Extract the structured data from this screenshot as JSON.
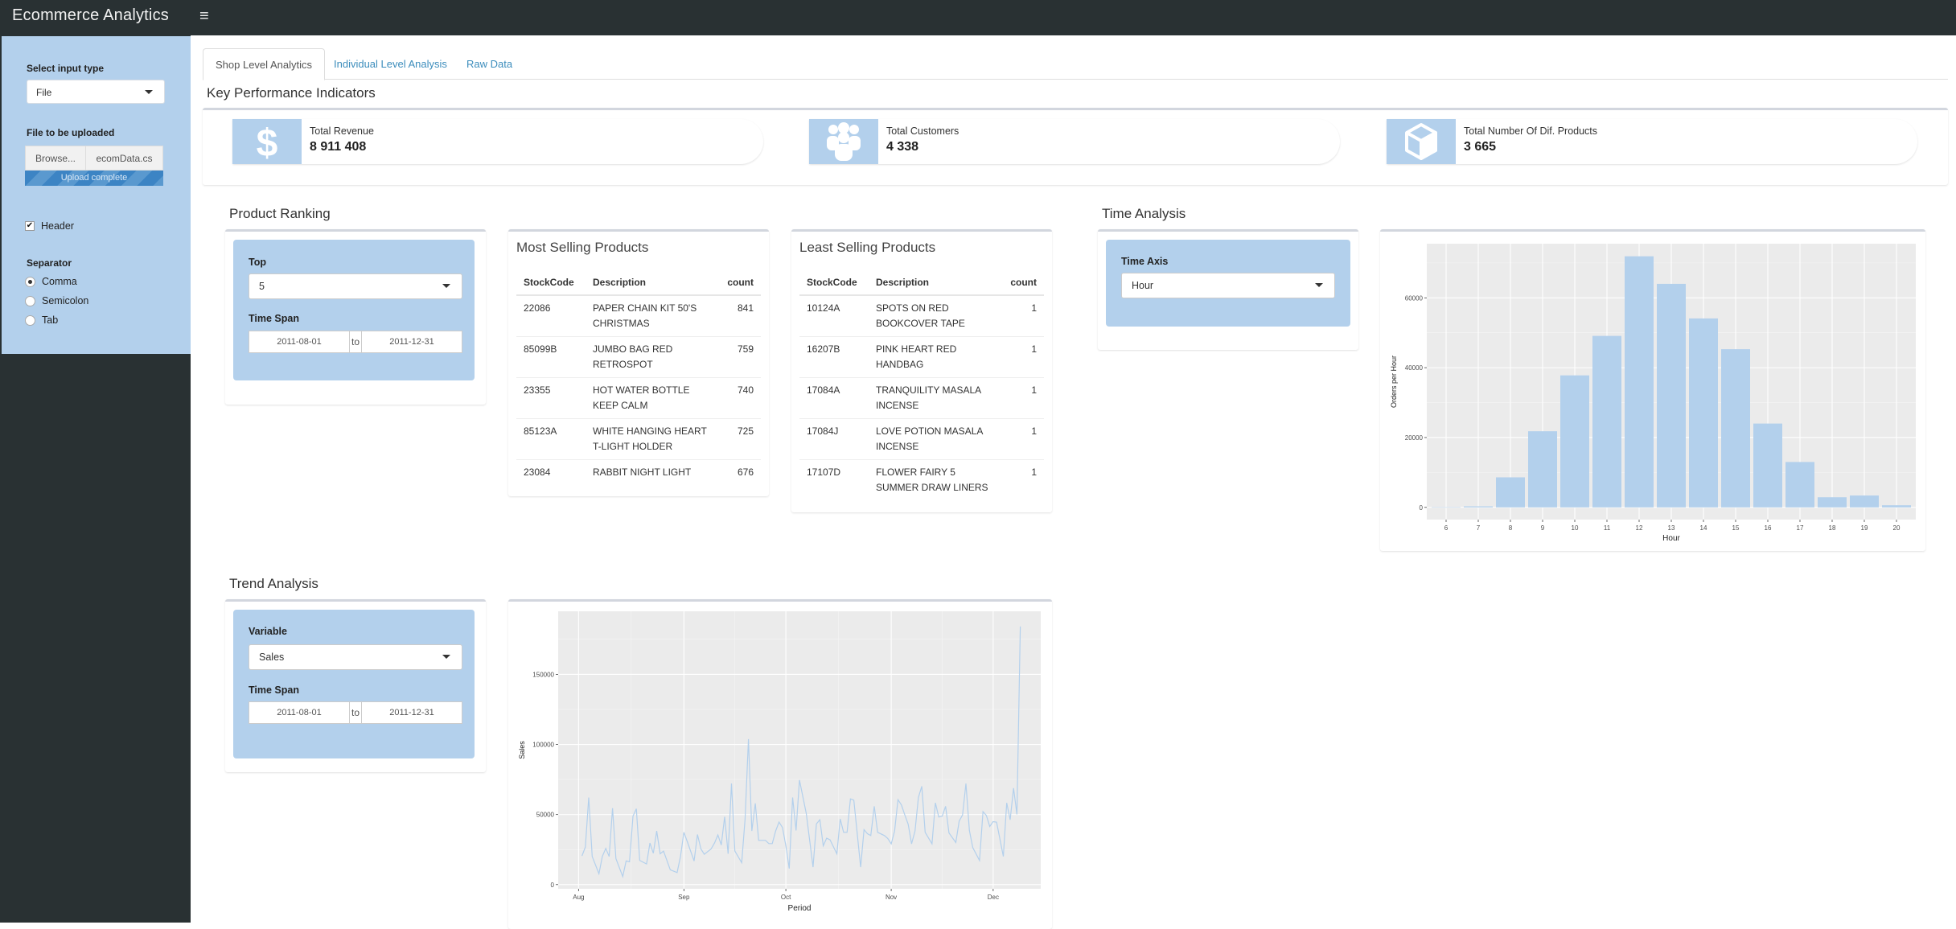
{
  "app": {
    "title": "Ecommerce Analytics",
    "menu_icon": "hamburger-icon"
  },
  "sidebar": {
    "input_type_label": "Select input type",
    "input_type_value": "File",
    "file_label": "File to be uploaded",
    "browse_label": "Browse...",
    "file_name": "ecomData.cs",
    "upload_status": "Upload complete",
    "upload_progress": 1.0,
    "header_label": "Header",
    "header_checked": true,
    "separator_label": "Separator",
    "separator_options": [
      {
        "label": "Comma",
        "selected": true
      },
      {
        "label": "Semicolon",
        "selected": false
      },
      {
        "label": "Tab",
        "selected": false
      }
    ]
  },
  "tabs": [
    {
      "label": "Shop Level Analytics",
      "active": true
    },
    {
      "label": "Individual Level Analysis",
      "active": false
    },
    {
      "label": "Raw Data",
      "active": false
    }
  ],
  "kpi": {
    "title": "Key Performance Indicators",
    "items": [
      {
        "icon": "dollar-icon",
        "label": "Total Revenue",
        "value": "8 911 408"
      },
      {
        "icon": "users-icon",
        "label": "Total Customers",
        "value": "4 338"
      },
      {
        "icon": "cube-icon",
        "label": "Total Number Of Dif. Products",
        "value": "3 665"
      }
    ]
  },
  "product_ranking": {
    "title": "Product Ranking",
    "top_label": "Top",
    "top_value": "5",
    "timespan_label": "Time Span",
    "date_from": "2011-08-01",
    "date_sep": "to",
    "date_to": "2011-12-31"
  },
  "most_selling": {
    "title": "Most Selling Products",
    "columns": [
      "StockCode",
      "Description",
      "count"
    ],
    "rows": [
      [
        "22086",
        "PAPER CHAIN KIT 50'S CHRISTMAS",
        "841"
      ],
      [
        "85099B",
        "JUMBO BAG RED RETROSPOT",
        "759"
      ],
      [
        "23355",
        "HOT WATER BOTTLE KEEP CALM",
        "740"
      ],
      [
        "85123A",
        "WHITE HANGING HEART T-LIGHT HOLDER",
        "725"
      ],
      [
        "23084",
        "RABBIT NIGHT LIGHT",
        "676"
      ]
    ]
  },
  "least_selling": {
    "title": "Least Selling Products",
    "columns": [
      "StockCode",
      "Description",
      "count"
    ],
    "rows": [
      [
        "10124A",
        "SPOTS ON RED BOOKCOVER TAPE",
        "1"
      ],
      [
        "16207B",
        "PINK HEART RED HANDBAG",
        "1"
      ],
      [
        "17084A",
        "TRANQUILITY MASALA INCENSE",
        "1"
      ],
      [
        "17084J",
        "LOVE POTION MASALA INCENSE",
        "1"
      ],
      [
        "17107D",
        "FLOWER FAIRY 5 SUMMER DRAW LINERS",
        "1"
      ]
    ]
  },
  "time_analysis": {
    "title": "Time Analysis",
    "axis_label": "Time Axis",
    "axis_value": "Hour"
  },
  "trend_analysis": {
    "title": "Trend Analysis",
    "variable_label": "Variable",
    "variable_value": "Sales",
    "timespan_label": "Time Span",
    "date_from": "2011-08-01",
    "date_sep": "to",
    "date_to": "2011-12-31"
  },
  "colors": {
    "bar": "#b3d0ec",
    "panel": "#ebebeb",
    "accent": "#3c8dbc",
    "topbar": "#293133"
  },
  "chart_data": [
    {
      "type": "bar",
      "title": "",
      "xlabel": "Hour",
      "ylabel": "Orders per  Hour",
      "categories": [
        "6",
        "7",
        "8",
        "9",
        "10",
        "11",
        "12",
        "13",
        "14",
        "15",
        "16",
        "17",
        "18",
        "19",
        "20"
      ],
      "values": [
        41,
        300,
        8600,
        21800,
        37800,
        49100,
        71900,
        64000,
        54100,
        45300,
        24000,
        13000,
        2900,
        3400,
        600
      ],
      "yticks": [
        0,
        20000,
        40000,
        60000
      ],
      "ylim": [
        -3500,
        75500
      ],
      "grid": true,
      "legend": "none"
    },
    {
      "type": "line",
      "title": "",
      "xlabel": "Period",
      "ylabel": "Sales",
      "xticks": [
        {
          "date": "2011-08-01",
          "label": "Aug"
        },
        {
          "date": "2011-09-01",
          "label": "Sep"
        },
        {
          "date": "2011-10-01",
          "label": "Oct"
        },
        {
          "date": "2011-11-01",
          "label": "Nov"
        },
        {
          "date": "2011-12-01",
          "label": "Dec"
        }
      ],
      "yticks": [
        0,
        50000,
        100000,
        150000
      ],
      "xlim": [
        "2011-07-26",
        "2011-12-15"
      ],
      "ylim": [
        -3000,
        195000
      ],
      "grid": true,
      "legend": "none",
      "series": [
        {
          "name": "Sales",
          "points": [
            [
              "2011-08-02",
              20450
            ],
            [
              "2011-08-03",
              26770
            ],
            [
              "2011-08-04",
              62140
            ],
            [
              "2011-08-05",
              20080
            ],
            [
              "2011-08-07",
              7650
            ],
            [
              "2011-08-08",
              20080
            ],
            [
              "2011-08-09",
              25810
            ],
            [
              "2011-08-10",
              20080
            ],
            [
              "2011-08-11",
              54490
            ],
            [
              "2011-08-12",
              18550
            ],
            [
              "2011-08-14",
              5740
            ],
            [
              "2011-08-15",
              16830
            ],
            [
              "2011-08-16",
              16250
            ],
            [
              "2011-08-17",
              48760
            ],
            [
              "2011-08-18",
              54110
            ],
            [
              "2011-08-19",
              17210
            ],
            [
              "2011-08-21",
              14720
            ],
            [
              "2011-08-22",
              29640
            ],
            [
              "2011-08-23",
              22370
            ],
            [
              "2011-08-24",
              38240
            ],
            [
              "2011-08-25",
              21990
            ],
            [
              "2011-08-26",
              23900
            ],
            [
              "2011-08-28",
              10520
            ],
            [
              "2011-08-30",
              8600
            ],
            [
              "2011-08-31",
              20080
            ],
            [
              "2011-09-01",
              37280
            ],
            [
              "2011-09-02",
              30590
            ],
            [
              "2011-09-04",
              16830
            ],
            [
              "2011-09-05",
              35760
            ],
            [
              "2011-09-06",
              25430
            ],
            [
              "2011-09-07",
              21610
            ],
            [
              "2011-09-09",
              25430
            ],
            [
              "2011-09-10",
              29640
            ],
            [
              "2011-09-11",
              35370
            ],
            [
              "2011-09-12",
              28300
            ],
            [
              "2011-09-13",
              48370
            ],
            [
              "2011-09-14",
              21990
            ],
            [
              "2011-09-15",
              72080
            ],
            [
              "2011-09-16",
              23900
            ],
            [
              "2011-09-18",
              15680
            ],
            [
              "2011-09-19",
              46840
            ],
            [
              "2011-09-20",
              103820
            ],
            [
              "2011-09-21",
              38240
            ],
            [
              "2011-09-22",
              57930
            ],
            [
              "2011-09-23",
              31550
            ],
            [
              "2011-09-25",
              31550
            ],
            [
              "2011-09-26",
              29250
            ],
            [
              "2011-09-27",
              29250
            ],
            [
              "2011-09-28",
              38240
            ],
            [
              "2011-09-29",
              44550
            ],
            [
              "2011-09-30",
              40730
            ],
            [
              "2011-10-01",
              27720
            ],
            [
              "2011-10-02",
              11470
            ],
            [
              "2011-10-03",
              62140
            ],
            [
              "2011-10-04",
              38620
            ],
            [
              "2011-10-05",
              74570
            ],
            [
              "2011-10-07",
              50670
            ],
            [
              "2011-10-09",
              12430
            ],
            [
              "2011-10-10",
              43400
            ],
            [
              "2011-10-11",
              46270
            ],
            [
              "2011-10-12",
              27720
            ],
            [
              "2011-10-13",
              33080
            ],
            [
              "2011-10-14",
              31930
            ],
            [
              "2011-10-16",
              21990
            ],
            [
              "2011-10-17",
              46840
            ],
            [
              "2011-10-18",
              37280
            ],
            [
              "2011-10-19",
              37280
            ],
            [
              "2011-10-20",
              61180
            ],
            [
              "2011-10-21",
              60230
            ],
            [
              "2011-10-23",
              12430
            ],
            [
              "2011-10-24",
              39200
            ],
            [
              "2011-10-25",
              36330
            ],
            [
              "2011-10-26",
              34990
            ],
            [
              "2011-10-27",
              55830
            ],
            [
              "2011-10-28",
              37280
            ],
            [
              "2011-10-30",
              34990
            ],
            [
              "2011-10-31",
              32890
            ],
            [
              "2011-11-01",
              29060
            ],
            [
              "2011-11-02",
              38240
            ],
            [
              "2011-11-03",
              60610
            ],
            [
              "2011-11-04",
              56790
            ],
            [
              "2011-11-05",
              49710
            ],
            [
              "2011-11-06",
              43020
            ],
            [
              "2011-11-07",
              29060
            ],
            [
              "2011-11-08",
              38240
            ],
            [
              "2011-11-09",
              62140
            ],
            [
              "2011-11-10",
              70170
            ],
            [
              "2011-11-11",
              37280
            ],
            [
              "2011-11-13",
              29060
            ],
            [
              "2011-11-14",
              58320
            ],
            [
              "2011-11-15",
              48180
            ],
            [
              "2011-11-16",
              48760
            ],
            [
              "2011-11-17",
              55830
            ],
            [
              "2011-11-18",
              36900
            ],
            [
              "2011-11-20",
              30020
            ],
            [
              "2011-11-21",
              45310
            ],
            [
              "2011-11-22",
              49710
            ],
            [
              "2011-11-23",
              72080
            ],
            [
              "2011-11-24",
              38620
            ],
            [
              "2011-11-25",
              26390
            ],
            [
              "2011-11-27",
              17210
            ],
            [
              "2011-11-28",
              52010
            ],
            [
              "2011-11-29",
              49330
            ],
            [
              "2011-11-30",
              41490
            ],
            [
              "2011-12-01",
              44930
            ],
            [
              "2011-12-02",
              44550
            ],
            [
              "2011-12-04",
              20080
            ],
            [
              "2011-12-05",
              58320
            ],
            [
              "2011-12-06",
              46270
            ],
            [
              "2011-12-07",
              68830
            ],
            [
              "2011-12-08",
              50090
            ],
            [
              "2011-12-09",
              184130
            ]
          ]
        }
      ]
    }
  ]
}
